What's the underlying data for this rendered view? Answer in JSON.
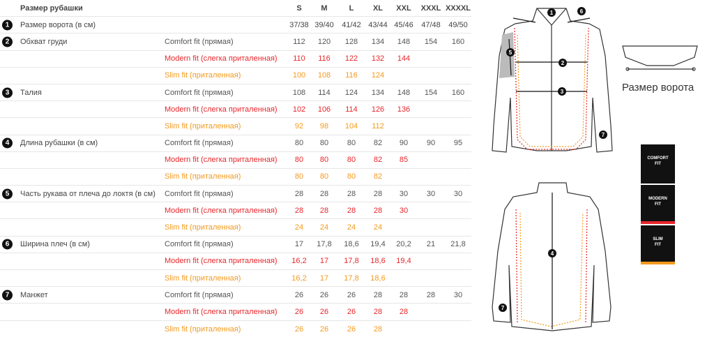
{
  "header": {
    "title": "Размер рубашки",
    "sizes": [
      "S",
      "M",
      "L",
      "XL",
      "XXL",
      "XXXL",
      "XXXXL"
    ]
  },
  "collar_row": {
    "num": "1",
    "name": "Размер ворота (в см)",
    "values": [
      "37/38",
      "39/40",
      "41/42",
      "43/44",
      "45/46",
      "47/48",
      "49/50"
    ]
  },
  "fits": {
    "comfort": "Comfort fit (прямая)",
    "modern": "Modern fit (слегка приталенная)",
    "slim": "Slim fit (приталенная)"
  },
  "measures": [
    {
      "num": "2",
      "name": "Обхват груди",
      "comfort": [
        "112",
        "120",
        "128",
        "134",
        "148",
        "154",
        "160"
      ],
      "modern": [
        "110",
        "116",
        "122",
        "132",
        "144"
      ],
      "slim": [
        "100",
        "108",
        "116",
        "124"
      ]
    },
    {
      "num": "3",
      "name": "Талия",
      "comfort": [
        "108",
        "114",
        "124",
        "134",
        "148",
        "154",
        "160"
      ],
      "modern": [
        "102",
        "106",
        "114",
        "126",
        "136"
      ],
      "slim": [
        "92",
        "98",
        "104",
        "112"
      ]
    },
    {
      "num": "4",
      "name": "Длина рубашки (в см)",
      "comfort": [
        "80",
        "80",
        "80",
        "82",
        "90",
        "90",
        "95"
      ],
      "modern": [
        "80",
        "80",
        "80",
        "82",
        "85"
      ],
      "slim": [
        "80",
        "80",
        "80",
        "82"
      ]
    },
    {
      "num": "5",
      "name": "Часть рукава от плеча до локтя (в см)",
      "comfort": [
        "28",
        "28",
        "28",
        "28",
        "30",
        "30",
        "30"
      ],
      "modern": [
        "28",
        "28",
        "28",
        "28",
        "30"
      ],
      "slim": [
        "24",
        "24",
        "24",
        "24"
      ]
    },
    {
      "num": "6",
      "name": "Ширина плеч (в см)",
      "comfort": [
        "17",
        "17,8",
        "18,6",
        "19,4",
        "20,2",
        "21",
        "21,8"
      ],
      "modern": [
        "16,2",
        "17",
        "17,8",
        "18,6",
        "19,4"
      ],
      "slim": [
        "16,2",
        "17",
        "17,8",
        "18,6"
      ]
    },
    {
      "num": "7",
      "name": "Манжет",
      "comfort": [
        "26",
        "26",
        "26",
        "28",
        "28",
        "28",
        "30"
      ],
      "modern": [
        "26",
        "26",
        "26",
        "28",
        "28"
      ],
      "slim": [
        "26",
        "26",
        "26",
        "28"
      ]
    }
  ],
  "diagram": {
    "collar_label": "Размер ворота",
    "markers": [
      "1",
      "2",
      "3",
      "4",
      "5",
      "6",
      "7"
    ],
    "badges": [
      {
        "line1": "COMFORT",
        "line2": "FIT",
        "color": "#111111"
      },
      {
        "line1": "MODERN",
        "line2": "FIT",
        "color": "#e8262b"
      },
      {
        "line1": "SLIM",
        "line2": "FIT",
        "color": "#f39a1e"
      }
    ]
  }
}
